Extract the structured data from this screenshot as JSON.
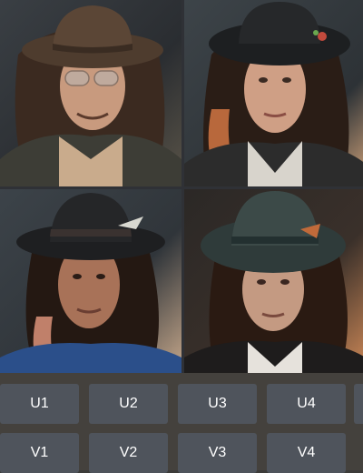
{
  "upscale_buttons": [
    {
      "label": "U1"
    },
    {
      "label": "U2"
    },
    {
      "label": "U3"
    },
    {
      "label": "U4"
    }
  ],
  "variation_buttons": [
    {
      "label": "V1"
    },
    {
      "label": "V2"
    },
    {
      "label": "V3"
    },
    {
      "label": "V4"
    }
  ],
  "colors": {
    "button_bg": "#4f545c",
    "button_text": "#ffffff",
    "panel_bg": "#44413d"
  }
}
